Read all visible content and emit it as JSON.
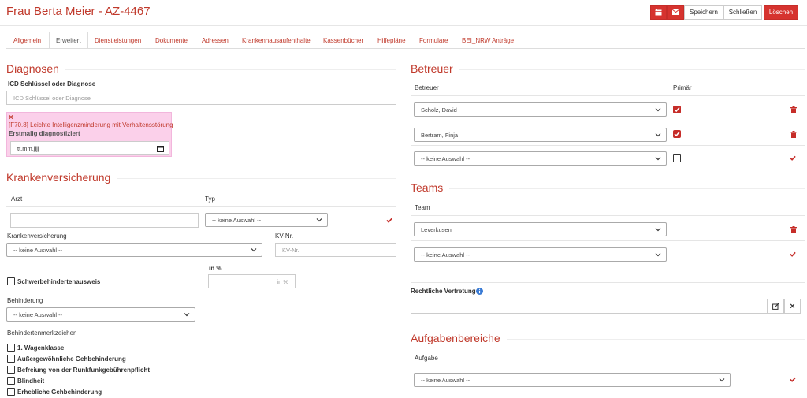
{
  "header": {
    "title": "Frau Berta Meier - AZ-4467",
    "speichern": "Speichern",
    "schliessen": "Schließen",
    "loeschen": "Löschen"
  },
  "tabs": [
    "Allgemein",
    "Erweitert",
    "Dienstleistungen",
    "Dokumente",
    "Adressen",
    "Krankenhausaufenthalte",
    "Kassenbücher",
    "Hilfepläne",
    "Formulare",
    "BEI_NRW Anträge"
  ],
  "diagnosen": {
    "heading": "Diagnosen",
    "icd_label": "ICD Schlüssel oder Diagnose",
    "icd_placeholder": "ICD Schlüssel oder Diagnose",
    "item_close": "×",
    "item_text": "[F70.8] Leichte Intelligenzminderung mit Verhaltensstörung",
    "item_sub_label": "Erstmalig diagnostiziert",
    "date_placeholder": "tt.mm.jjjj"
  },
  "kv": {
    "heading": "Krankenversicherung",
    "arzt_label": "Arzt",
    "typ_label": "Typ",
    "typ_value": "-- keine Auswahl --",
    "kv_label": "Krankenversicherung",
    "kv_value": "-- keine Auswahl --",
    "kvnr_label": "KV-Nr.",
    "kvnr_placeholder": "KV-Nr.",
    "in_pct_label": "in %",
    "in_pct_placeholder": "in %",
    "schwerb_label": "Schwerbehindertenausweis",
    "behinderung_label": "Behinderung",
    "behinderung_value": "-- keine Auswahl --",
    "merkzeichen_label": "Behindertenmerkzeichen",
    "merkzeichen": [
      "1. Wagenklasse",
      "Außergewöhnliche Gehbehinderung",
      "Befreiung von der Runkfunkgebührenpflicht",
      "Blindheit",
      "Erhebliche Gehbehinderung"
    ]
  },
  "betreuer": {
    "heading": "Betreuer",
    "col_betreuer": "Betreuer",
    "col_primaer": "Primär",
    "rows": [
      {
        "value": "Scholz, David",
        "primary": true
      },
      {
        "value": "Bertram, Finja",
        "primary": true
      },
      {
        "value": "-- keine Auswahl --",
        "primary": false
      }
    ]
  },
  "teams": {
    "heading": "Teams",
    "col_team": "Team",
    "rows": [
      "Leverkusen",
      "-- keine Auswahl --"
    ]
  },
  "rechtliche": {
    "label": "Rechtliche Vertretung",
    "clear": "×"
  },
  "aufgaben": {
    "heading": "Aufgabenbereiche",
    "col_aufgabe": "Aufgabe",
    "value": "-- keine Auswahl --"
  },
  "colors": {
    "accent": "#c0392b",
    "button_red": "#d6332f",
    "diag_bg": "#fbd0ea"
  }
}
